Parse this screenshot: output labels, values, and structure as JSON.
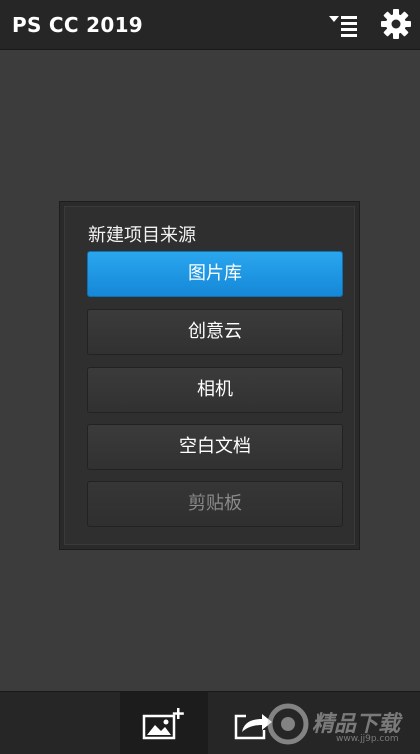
{
  "header": {
    "title": "PS CC 2019",
    "sort_icon": "sort-list-icon",
    "settings_icon": "gear-icon"
  },
  "dialog": {
    "title": "新建项目来源",
    "options": [
      {
        "label": "图片库",
        "state": "selected"
      },
      {
        "label": "创意云",
        "state": "normal"
      },
      {
        "label": "相机",
        "state": "normal"
      },
      {
        "label": "空白文档",
        "state": "normal"
      },
      {
        "label": "剪贴板",
        "state": "disabled"
      }
    ]
  },
  "bottom_bar": {
    "tabs": [
      {
        "icon": "add-image-icon",
        "active": true
      },
      {
        "icon": "share-icon",
        "active": false
      }
    ]
  },
  "watermark": {
    "text": "精品下载",
    "url": "www.jj9p.com"
  },
  "colors": {
    "accent": "#1e97e4",
    "background": "#3c3c3c",
    "bar": "#262626"
  }
}
